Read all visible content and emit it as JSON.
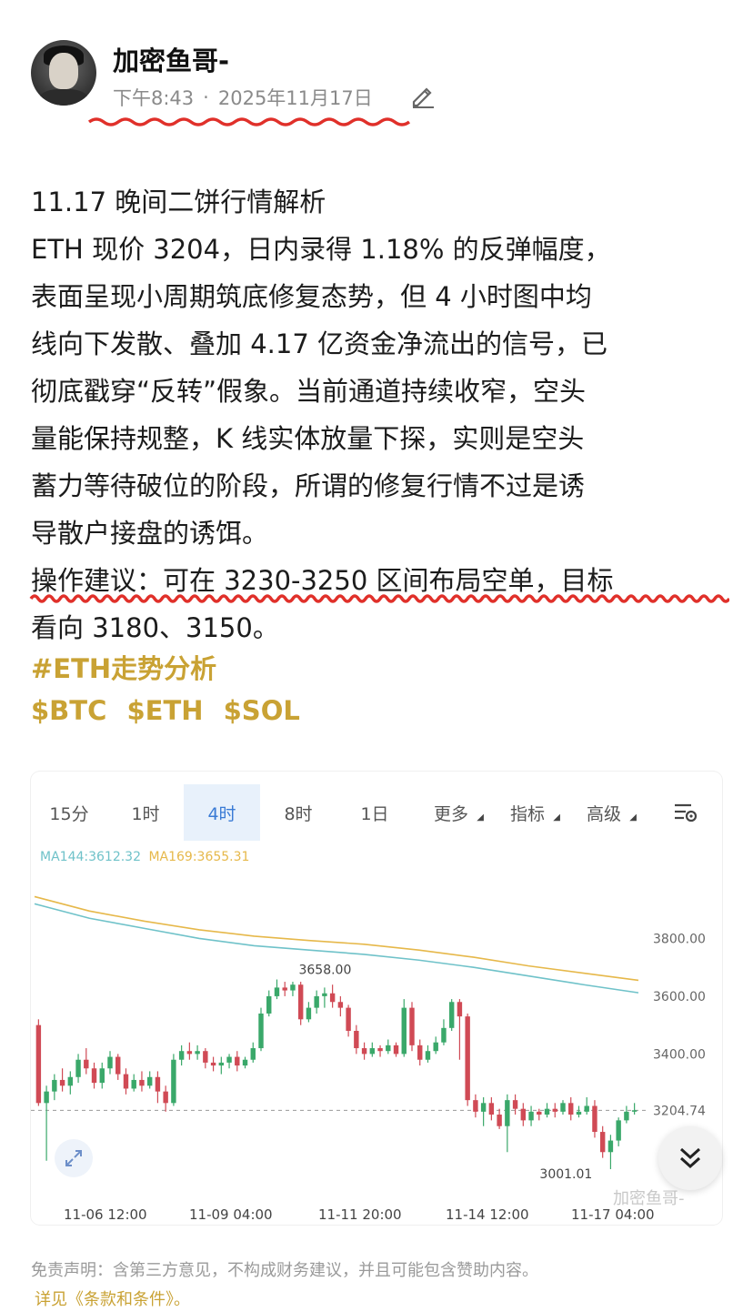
{
  "post": {
    "username": "加密鱼哥-",
    "time": "下午8:43",
    "separator": "·",
    "date": "2025年11月17日",
    "title_line": "11.17 晚间二饼行情解析",
    "body": [
      "ETH 现价 3204，日内录得 1.18% 的反弹幅度，",
      "表面呈现小周期筑底修复态势，但 4 小时图中均",
      "线向下发散、叠加 4.17 亿资金净流出的信号，已",
      "彻底戳穿“反转”假象。当前通道持续收窄，空头",
      "量能保持规整，K 线实体放量下探，实则是空头",
      "蓄力等待破位的阶段，所谓的修复行情不过是诱",
      "导散户接盘的诱饵。",
      "操作建议：可在 3230-3250 区间布局空单，目标",
      "看向 3180、3150。"
    ],
    "hashtag": "#ETH走势分析",
    "cashtags": [
      "$BTC",
      "$ETH",
      "$SOL"
    ]
  },
  "chart_card": {
    "timeframes": [
      {
        "label": "15分",
        "active": false,
        "dropdown": false
      },
      {
        "label": "1时",
        "active": false,
        "dropdown": false
      },
      {
        "label": "4时",
        "active": true,
        "dropdown": false
      },
      {
        "label": "8时",
        "active": false,
        "dropdown": false
      },
      {
        "label": "1日",
        "active": false,
        "dropdown": false
      },
      {
        "label": "更多",
        "active": false,
        "dropdown": true
      },
      {
        "label": "指标",
        "active": false,
        "dropdown": true
      },
      {
        "label": "高级",
        "active": false,
        "dropdown": true
      }
    ],
    "ma144_label": "MA144:3612.32",
    "ma169_label": "MA169:3655.31",
    "watermark": "加密鱼哥-"
  },
  "chart_data": {
    "type": "candlestick",
    "ylim": [
      2960,
      4000
    ],
    "y_ticks": [
      "3800.00",
      "3600.00",
      "3400.00"
    ],
    "current_price_label": "3204.74",
    "current_price": 3204.74,
    "high_label": "3658.00",
    "high": 3658,
    "low_label": "3001.01",
    "low": 3001.01,
    "x_ticks": [
      "11-06 12:00",
      "11-09 04:00",
      "11-11 20:00",
      "11-14 12:00",
      "11-17 04:00"
    ],
    "colors": {
      "up": "#3aa86a",
      "down": "#d04a55",
      "ma144": "#6fc2c9",
      "ma169": "#e6b84a"
    },
    "ma144": [
      3920,
      3870,
      3835,
      3800,
      3775,
      3760,
      3745,
      3725,
      3700,
      3670,
      3640,
      3612
    ],
    "ma169": [
      3945,
      3895,
      3860,
      3830,
      3808,
      3793,
      3780,
      3760,
      3735,
      3705,
      3680,
      3655
    ],
    "candles": [
      [
        3500,
        3230,
        3520,
        3220
      ],
      [
        3230,
        3270,
        3290,
        3030
      ],
      [
        3270,
        3310,
        3330,
        3240
      ],
      [
        3310,
        3290,
        3350,
        3270
      ],
      [
        3290,
        3320,
        3340,
        3260
      ],
      [
        3320,
        3380,
        3400,
        3300
      ],
      [
        3380,
        3350,
        3420,
        3330
      ],
      [
        3350,
        3300,
        3370,
        3280
      ],
      [
        3300,
        3350,
        3370,
        3280
      ],
      [
        3350,
        3390,
        3410,
        3330
      ],
      [
        3390,
        3330,
        3400,
        3310
      ],
      [
        3330,
        3280,
        3350,
        3260
      ],
      [
        3280,
        3310,
        3330,
        3270
      ],
      [
        3310,
        3290,
        3340,
        3270
      ],
      [
        3290,
        3320,
        3340,
        3280
      ],
      [
        3320,
        3270,
        3340,
        3230
      ],
      [
        3270,
        3230,
        3290,
        3200
      ],
      [
        3230,
        3380,
        3400,
        3220
      ],
      [
        3380,
        3410,
        3430,
        3360
      ],
      [
        3410,
        3400,
        3440,
        3380
      ],
      [
        3400,
        3410,
        3430,
        3380
      ],
      [
        3410,
        3370,
        3420,
        3350
      ],
      [
        3370,
        3360,
        3390,
        3340
      ],
      [
        3360,
        3370,
        3390,
        3330
      ],
      [
        3370,
        3390,
        3400,
        3350
      ],
      [
        3390,
        3360,
        3410,
        3340
      ],
      [
        3360,
        3380,
        3390,
        3350
      ],
      [
        3380,
        3420,
        3440,
        3370
      ],
      [
        3420,
        3540,
        3560,
        3410
      ],
      [
        3540,
        3600,
        3620,
        3530
      ],
      [
        3600,
        3630,
        3658,
        3590
      ],
      [
        3630,
        3620,
        3650,
        3600
      ],
      [
        3620,
        3640,
        3650,
        3600
      ],
      [
        3640,
        3520,
        3650,
        3500
      ],
      [
        3520,
        3560,
        3580,
        3510
      ],
      [
        3560,
        3600,
        3620,
        3540
      ],
      [
        3600,
        3610,
        3630,
        3560
      ],
      [
        3610,
        3580,
        3640,
        3560
      ],
      [
        3580,
        3560,
        3600,
        3530
      ],
      [
        3560,
        3480,
        3570,
        3460
      ],
      [
        3480,
        3420,
        3500,
        3400
      ],
      [
        3420,
        3400,
        3440,
        3380
      ],
      [
        3400,
        3420,
        3440,
        3390
      ],
      [
        3420,
        3410,
        3430,
        3390
      ],
      [
        3410,
        3430,
        3450,
        3400
      ],
      [
        3430,
        3400,
        3440,
        3390
      ],
      [
        3400,
        3560,
        3590,
        3390
      ],
      [
        3560,
        3430,
        3580,
        3410
      ],
      [
        3430,
        3380,
        3450,
        3360
      ],
      [
        3380,
        3410,
        3430,
        3370
      ],
      [
        3410,
        3440,
        3460,
        3400
      ],
      [
        3440,
        3490,
        3520,
        3430
      ],
      [
        3490,
        3580,
        3590,
        3480
      ],
      [
        3580,
        3530,
        3590,
        3380
      ],
      [
        3530,
        3240,
        3540,
        3220
      ],
      [
        3240,
        3200,
        3260,
        3180
      ],
      [
        3200,
        3230,
        3250,
        3150
      ],
      [
        3230,
        3190,
        3250,
        3170
      ],
      [
        3190,
        3150,
        3210,
        3140
      ],
      [
        3150,
        3240,
        3260,
        3060
      ],
      [
        3240,
        3210,
        3260,
        3190
      ],
      [
        3210,
        3170,
        3230,
        3150
      ],
      [
        3170,
        3200,
        3220,
        3150
      ],
      [
        3200,
        3190,
        3210,
        3170
      ],
      [
        3190,
        3210,
        3230,
        3180
      ],
      [
        3210,
        3200,
        3230,
        3180
      ],
      [
        3200,
        3230,
        3240,
        3190
      ],
      [
        3230,
        3190,
        3250,
        3170
      ],
      [
        3190,
        3200,
        3220,
        3180
      ],
      [
        3200,
        3220,
        3250,
        3190
      ],
      [
        3220,
        3130,
        3240,
        3110
      ],
      [
        3130,
        3060,
        3150,
        3040
      ],
      [
        3060,
        3100,
        3120,
        3001
      ],
      [
        3100,
        3170,
        3180,
        3080
      ],
      [
        3170,
        3200,
        3220,
        3160
      ],
      [
        3200,
        3205,
        3230,
        3190
      ]
    ]
  },
  "footer": {
    "disclaimer": "免责声明：含第三方意见，不构成财务建议，并且可能包含赞助内容。",
    "terms": "详见《条款和条件》。"
  }
}
